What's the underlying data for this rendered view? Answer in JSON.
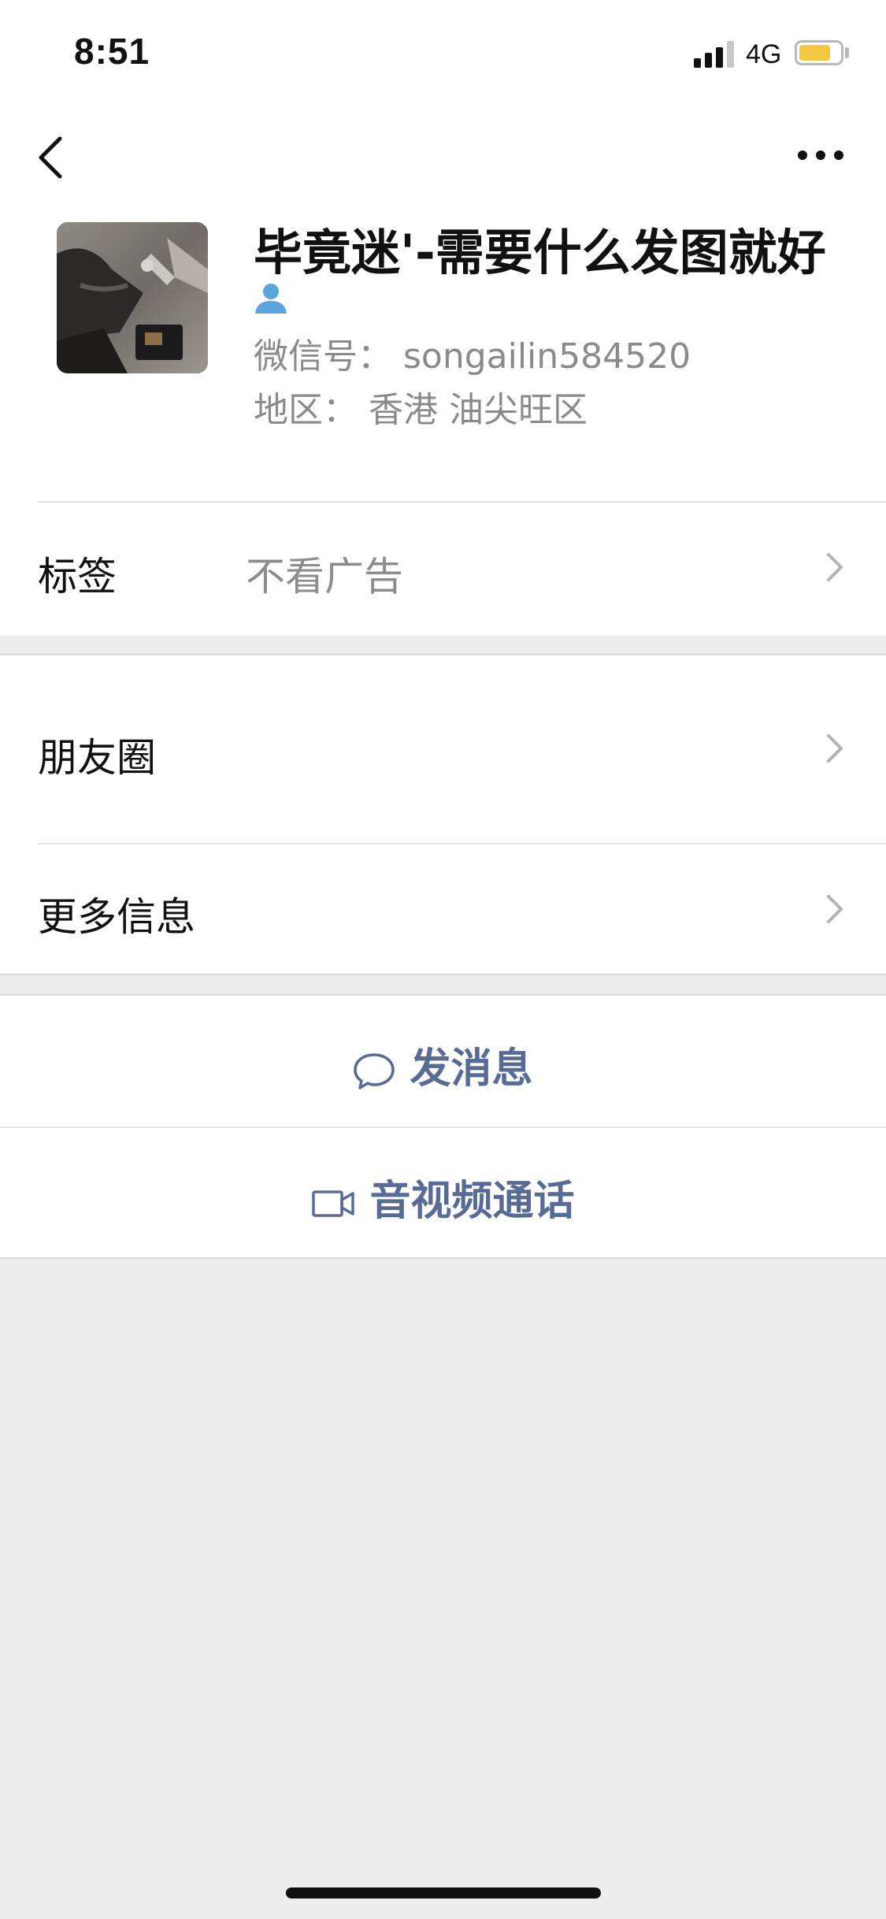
{
  "status_bar": {
    "time": "8:51",
    "network": "4G",
    "battery_level": 0.78,
    "battery_color": "#f5c842",
    "signal_bars": 3
  },
  "nav": {
    "back_icon": "chevron-left-icon",
    "more_icon": "ellipsis-icon"
  },
  "profile": {
    "name": "毕竟迷'-需要什么发图就好",
    "contact_type_icon": "person-icon",
    "wechat_id": "微信号： songailin584520",
    "region": "地区： 香港 油尖旺区"
  },
  "tags": {
    "label": "标签",
    "value": "不看广告"
  },
  "rows": {
    "moments": "朋友圈",
    "more_info": "更多信息"
  },
  "actions": {
    "send_message": "发消息",
    "av_call": "音视频通话"
  },
  "colors": {
    "link": "#576b95",
    "background": "#ededed"
  }
}
